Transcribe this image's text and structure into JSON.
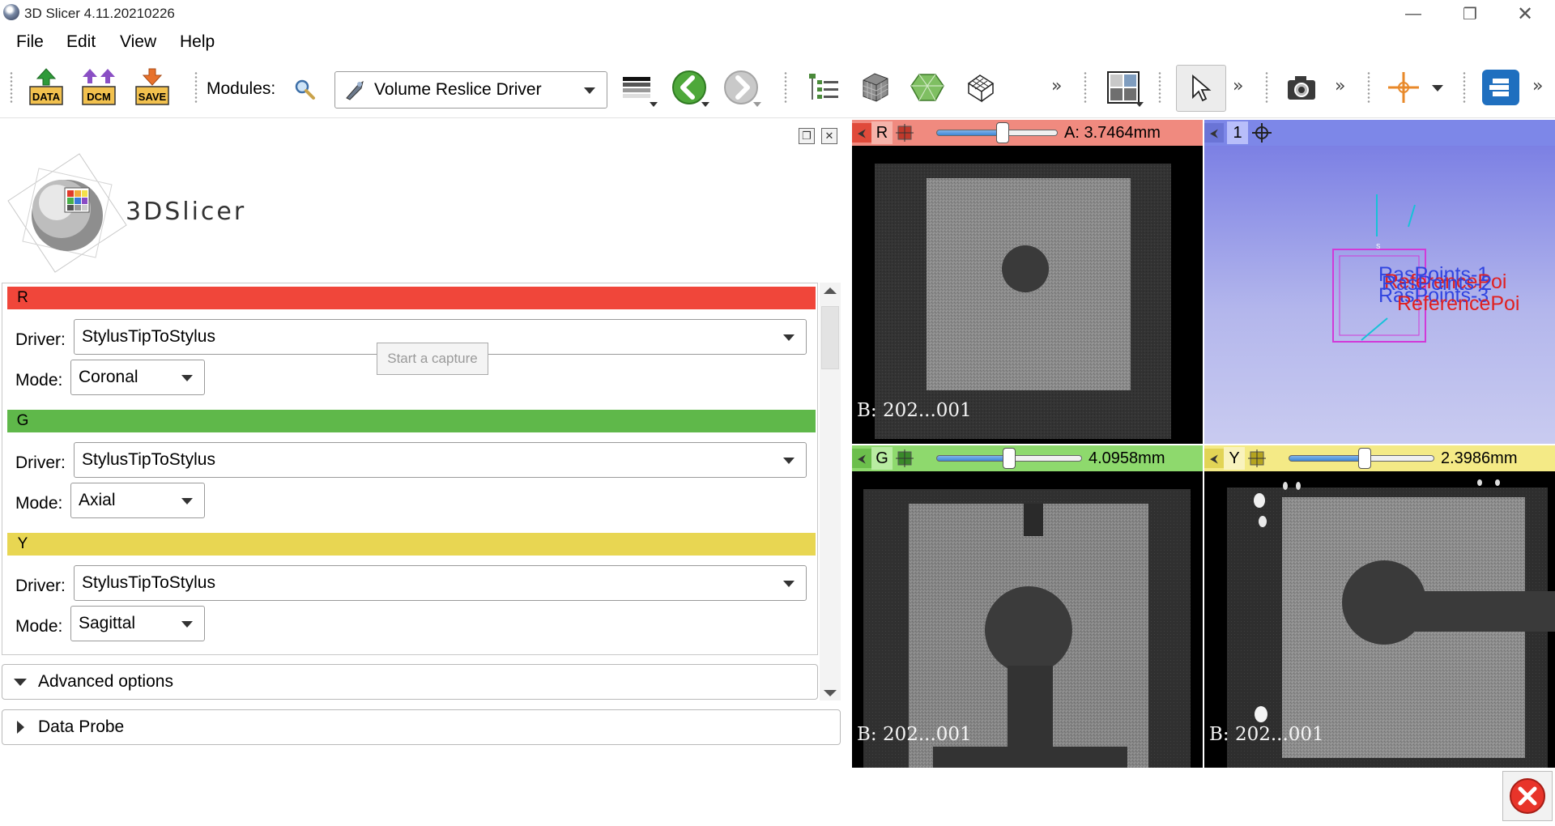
{
  "window": {
    "title": "3D Slicer 4.11.20210226"
  },
  "menu": {
    "items": [
      "File",
      "Edit",
      "View",
      "Help"
    ],
    "mnemonics": [
      "F",
      "E",
      "V",
      "H"
    ]
  },
  "toolbar": {
    "data_label": "DATA",
    "dcm_label": "DCM",
    "save_label": "SAVE",
    "modules_label": "Modules:",
    "module_selected": "Volume Reslice Driver",
    "overflow": "»"
  },
  "logo": {
    "text": "3DSlicer"
  },
  "reslice": {
    "sections": [
      {
        "tag": "R",
        "color": "#f0463a",
        "driver_label": "Driver:",
        "driver": "StylusTipToStylus",
        "mode_label": "Mode:",
        "mode": "Coronal"
      },
      {
        "tag": "G",
        "color": "#5fb84a",
        "driver_label": "Driver:",
        "driver": "StylusTipToStylus",
        "mode_label": "Mode:",
        "mode": "Axial"
      },
      {
        "tag": "Y",
        "color": "#e8d652",
        "driver_label": "Driver:",
        "driver": "StylusTipToStylus",
        "mode_label": "Mode:",
        "mode": "Sagittal"
      }
    ],
    "tooltip": "Start a capture"
  },
  "panels": {
    "advanced": "Advanced options",
    "data_probe": "Data Probe"
  },
  "views": {
    "red": {
      "letter": "R",
      "value": "A: 3.7464mm",
      "slider_pct": 55,
      "background": "B: 202...001",
      "bar_color": "#f08a7f"
    },
    "green": {
      "letter": "G",
      "value": "4.0958mm",
      "slider_pct": 50,
      "background": "B: 202...001",
      "bar_color": "#8ed96d"
    },
    "yellow": {
      "letter": "Y",
      "value": "2.3986mm",
      "slider_pct": 52,
      "background": "B: 202...001",
      "bar_color": "#f4ea86"
    },
    "threeD": {
      "letter": "1",
      "bar_color": "#7d87e8",
      "labels": {
        "ras1": "RasPoints-1",
        "ras2": "RasPoints-2",
        "ras3": "RasPoints-3",
        "ref": "ReferencePoi",
        "ref2": "ReferencePoi",
        "s": "S"
      }
    }
  }
}
